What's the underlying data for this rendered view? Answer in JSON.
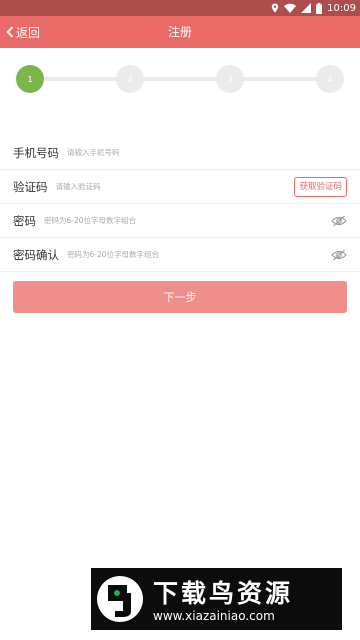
{
  "status_bar": {
    "time": "10:09"
  },
  "header": {
    "back_label": "返回",
    "title": "注册"
  },
  "stepper": {
    "steps": [
      "1",
      "2",
      "3",
      "4"
    ],
    "active_step": 1
  },
  "form": {
    "phone": {
      "label": "手机号码",
      "placeholder": "请输入手机号码"
    },
    "code": {
      "label": "验证码",
      "placeholder": "请输入验证码",
      "button_label": "获取验证码"
    },
    "password": {
      "label": "密码",
      "placeholder": "密码为6-20位字母数字组合"
    },
    "confirm": {
      "label": "密码确认",
      "placeholder": "密码为6-20位字母数字组合"
    }
  },
  "next_button": {
    "label": "下一步"
  },
  "watermark": {
    "title": "下载鸟资源",
    "url": "www.xiazainiao.com"
  },
  "colors": {
    "status_bar": "#ad4e4c",
    "header": "#e96a67",
    "accent": "#e96a67",
    "step_active": "#7cb64b",
    "next_button": "#f08e8b"
  },
  "icons": [
    "location-icon",
    "wifi-icon",
    "signal-icon",
    "battery-icon",
    "chevron-left-icon",
    "eye-off-icon"
  ]
}
